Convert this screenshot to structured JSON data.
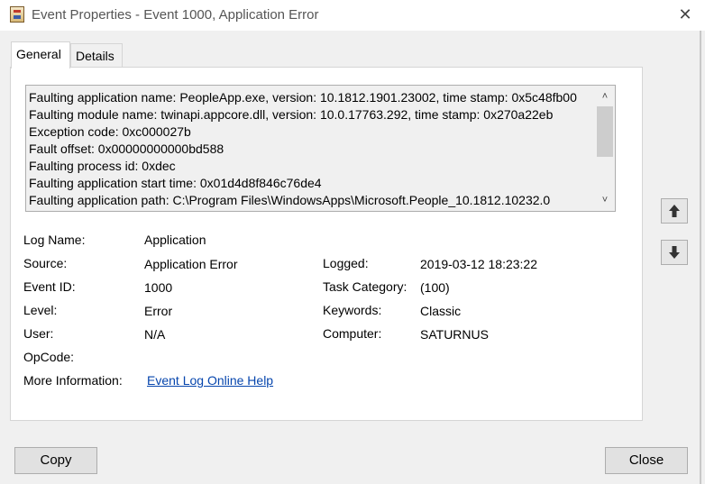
{
  "window": {
    "title": "Event Properties - Event 1000, Application Error",
    "app_icon": "event-viewer-icon",
    "close_icon": "close-icon",
    "close_glyph": "✕"
  },
  "tabs": [
    {
      "label": "General",
      "active": true
    },
    {
      "label": "Details",
      "active": false
    }
  ],
  "description": {
    "lines": [
      "Faulting application name: PeopleApp.exe, version: 10.1812.1901.23002, time stamp: 0x5c48fb00",
      "Faulting module name: twinapi.appcore.dll, version: 10.0.17763.292, time stamp: 0x270a22eb",
      "Exception code: 0xc000027b",
      "Fault offset: 0x00000000000bd588",
      "Faulting process id: 0xdec",
      "Faulting application start time: 0x01d4d8f846c76de4",
      "Faulting application path: C:\\Program Files\\WindowsApps\\Microsoft.People_10.1812.10232.0"
    ],
    "scroll_up_glyph": "˄",
    "scroll_down_glyph": "˅"
  },
  "fields": {
    "log_name": {
      "label": "Log Name:",
      "value": "Application"
    },
    "source": {
      "label": "Source:",
      "value": "Application Error"
    },
    "logged": {
      "label": "Logged:",
      "value": "2019-03-12 18:23:22"
    },
    "event_id": {
      "label": "Event ID:",
      "value": "1000"
    },
    "task_category": {
      "label": "Task Category:",
      "value": "(100)"
    },
    "level": {
      "label": "Level:",
      "value": "Error"
    },
    "keywords": {
      "label": "Keywords:",
      "value": "Classic"
    },
    "user": {
      "label": "User:",
      "value": "N/A"
    },
    "computer": {
      "label": "Computer:",
      "value": "SATURNUS"
    },
    "opcode": {
      "label": "OpCode:",
      "value": ""
    },
    "more_info": {
      "label": "More Information:",
      "link": "Event Log Online Help"
    }
  },
  "nav": {
    "up_icon": "arrow-up-icon",
    "down_icon": "arrow-down-icon"
  },
  "buttons": {
    "copy": "Copy",
    "close": "Close"
  }
}
